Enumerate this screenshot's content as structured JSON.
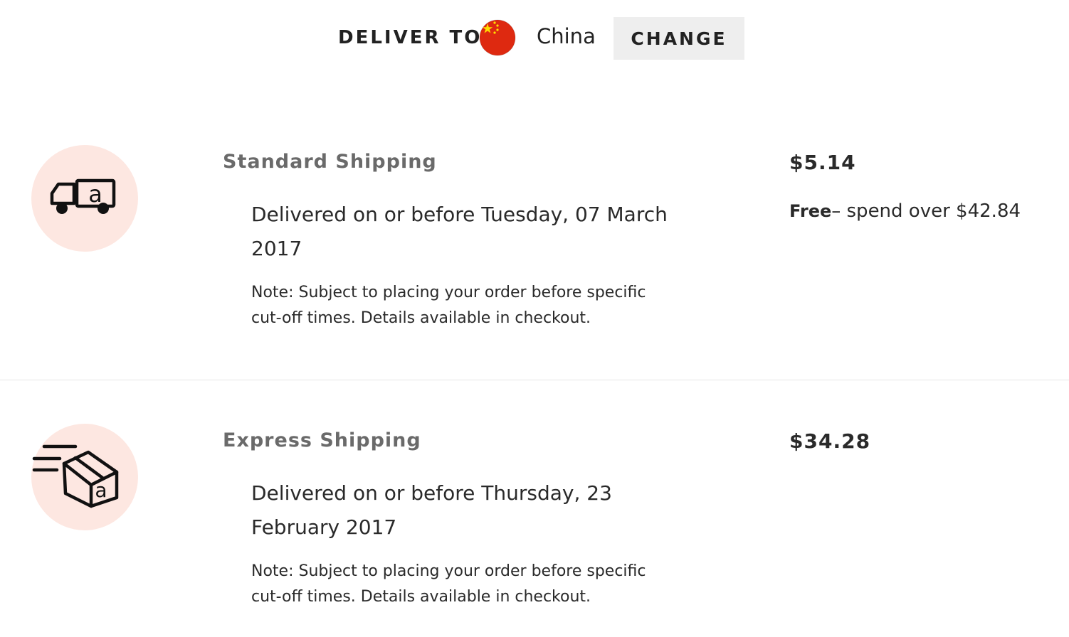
{
  "deliver": {
    "label": "DELIVER TO",
    "country": "China",
    "flag_icon": "china-flag-icon",
    "change_label": "CHANGE"
  },
  "shipping_options": [
    {
      "icon": "delivery-truck-icon",
      "title": "Standard Shipping",
      "date": "Delivered on or before Tuesday, 07 March 2017",
      "note": "Note: Subject to placing your order before specific cut-off times. Details available in checkout.",
      "price": "$5.14",
      "free_label": "Free",
      "free_text": "– spend over $42.84"
    },
    {
      "icon": "express-package-icon",
      "title": "Express Shipping",
      "date": "Delivered on or before Thursday, 23 February 2017",
      "note": "Note: Subject to placing your order before specific cut-off times. Details available in checkout.",
      "price": "$34.28"
    }
  ],
  "colors": {
    "icon_circle": "#fde7e1",
    "change_button_bg": "#eeeeee",
    "title_gray": "#6a6a6a",
    "text": "#2a2a2a",
    "flag_red": "#de2910",
    "flag_star": "#ffde00"
  }
}
